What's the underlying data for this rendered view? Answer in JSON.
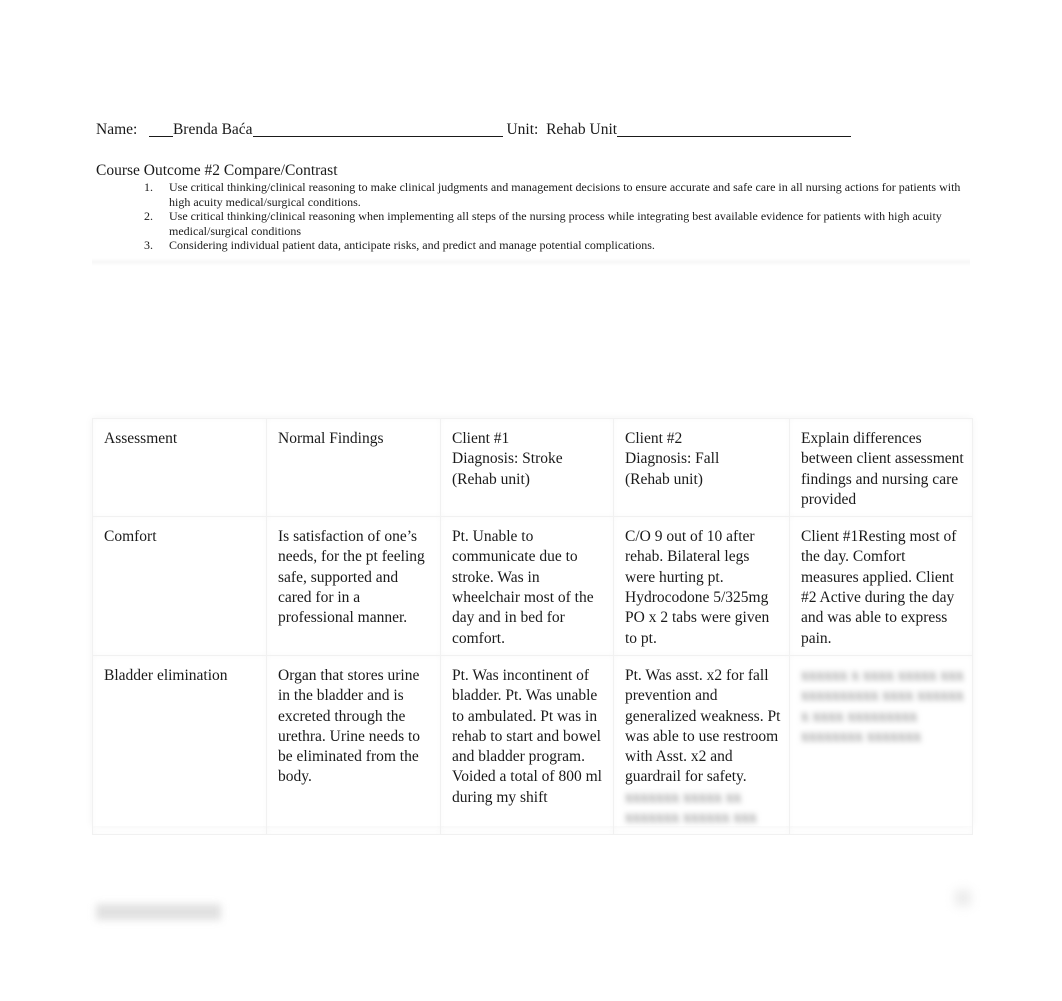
{
  "header": {
    "name_label": "Name:",
    "name_value": "Brenda Baća",
    "unit_label": "Unit:",
    "unit_value": "Rehab Unit"
  },
  "course_outcome": {
    "title": "Course Outcome #2 Compare/Contrast",
    "items": [
      {
        "number": "1.",
        "text": "Use critical thinking/clinical reasoning to make clinical judgments and management decisions to ensure accurate and safe care in all nursing actions for patients with high acuity medical/surgical conditions."
      },
      {
        "number": "2.",
        "text": "Use critical thinking/clinical reasoning when implementing all steps of the nursing process while integrating best available evidence for patients with high acuity medical/surgical conditions"
      },
      {
        "number": "3.",
        "text": "Considering individual patient data, anticipate risks, and predict and manage potential complications."
      }
    ]
  },
  "table": {
    "headers": [
      [
        "Assessment"
      ],
      [
        "Normal Findings"
      ],
      [
        "Client #1",
        "Diagnosis: Stroke",
        "(Rehab unit)"
      ],
      [
        "Client #2",
        "Diagnosis: Fall",
        "(Rehab unit)"
      ],
      [
        "Explain differences between client assessment findings and nursing care provided"
      ]
    ],
    "rows": [
      {
        "assessment": "Comfort",
        "normal_findings": "Is satisfaction of one’s needs, for the pt feeling safe, supported and cared for in a professional manner.",
        "client1": "Pt. Unable to communicate due to stroke. Was in wheelchair most of the day and in bed for comfort.",
        "client2": "C/O 9 out of 10 after rehab. Bilateral legs were hurting pt. Hydrocodone 5/325mg PO x 2 tabs were given to pt.",
        "explain": "Client #1Resting most of the day. Comfort measures applied. Client #2 Active during the day and was able to express pain."
      },
      {
        "assessment": "Bladder elimination",
        "normal_findings": "Organ that stores urine in the bladder and is excreted through the urethra. Urine needs to be eliminated from the body.",
        "client1": "Pt. Was incontinent of bladder. Pt. Was unable to ambulated. Pt was in rehab to start and bowel and bladder program. Voided a total of 800 ml during my shift",
        "client2": "Pt. Was asst. x2 for fall prevention and generalized weakness. Pt was able to use restroom with Asst. x2 and guardrail for safety.",
        "client2_blurred": "xxxxxxx xxxxx xx xxxxxxx xxxxxx xxx",
        "explain_blurred": "xxxxxx x xxxx xxxxx xxx xxxxxxxxxx xxxx xxxxxx x xxxx xxxxxxxxx xxxxxxxx xxxxxxx"
      }
    ]
  },
  "footer": {
    "blurred_label": "xxx xxxxxxxxx",
    "blurred_page": "x"
  }
}
